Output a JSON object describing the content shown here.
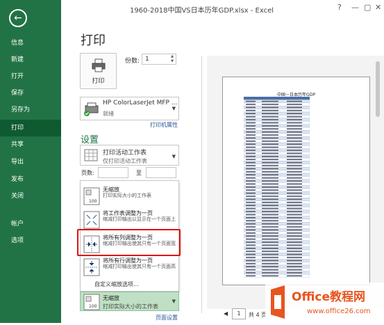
{
  "window": {
    "title": "1960-2018中国VS日本历年GDP.xlsx - Excel",
    "help": "?",
    "minimize": "—",
    "restore": "▢",
    "close": "✕"
  },
  "sidebar": {
    "back_icon": "back-arrow-icon",
    "items": [
      {
        "label": "信息"
      },
      {
        "label": "新建"
      },
      {
        "label": "打开"
      },
      {
        "label": "保存"
      },
      {
        "label": "另存为"
      },
      {
        "label": "打印"
      },
      {
        "label": "共享"
      },
      {
        "label": "导出"
      },
      {
        "label": "发布"
      },
      {
        "label": "关闭"
      },
      {
        "label": "帐户"
      },
      {
        "label": "选项"
      }
    ],
    "active": "打印"
  },
  "print": {
    "title": "打印",
    "button_label": "打印",
    "copies_label": "份数:",
    "copies_value": "1"
  },
  "printer": {
    "name": "HP ColorLaserJet MFP ...",
    "status": "就绪",
    "properties_link": "打印机属性"
  },
  "settings": {
    "title": "设置",
    "print_what": {
      "main": "打印活动工作表",
      "sub": "仅打印活动工作表"
    },
    "pages_label": "页数:",
    "to_label": "至"
  },
  "scaling_menu": {
    "items": [
      {
        "title": "无缩放",
        "desc": "打印实际大小的工作表"
      },
      {
        "title": "将工作表调整为一页",
        "desc": "缩减打印输出以显示在一个页面上"
      },
      {
        "title": "将所有列调整为一页",
        "desc": "缩减打印输出使其只有一个页面宽"
      },
      {
        "title": "将所有行调整为一页",
        "desc": "缩减打印输出使其只有一个页面高"
      }
    ],
    "custom": "自定义缩放选项..."
  },
  "scaling_selected": {
    "title": "无缩放",
    "desc": "打印实际大小的工作表"
  },
  "page_setup": "页面设置",
  "preview": {
    "sheet_title": "中国－日本历年GDP",
    "page_current": "1",
    "page_total_label": "共 4 页"
  },
  "watermark": {
    "brand": "Office教程网",
    "url": "www.office26.com"
  },
  "colors": {
    "accent": "#217346",
    "highlight": "#e01010",
    "selected": "#bfe0c4",
    "watermark": "#e8541e"
  }
}
